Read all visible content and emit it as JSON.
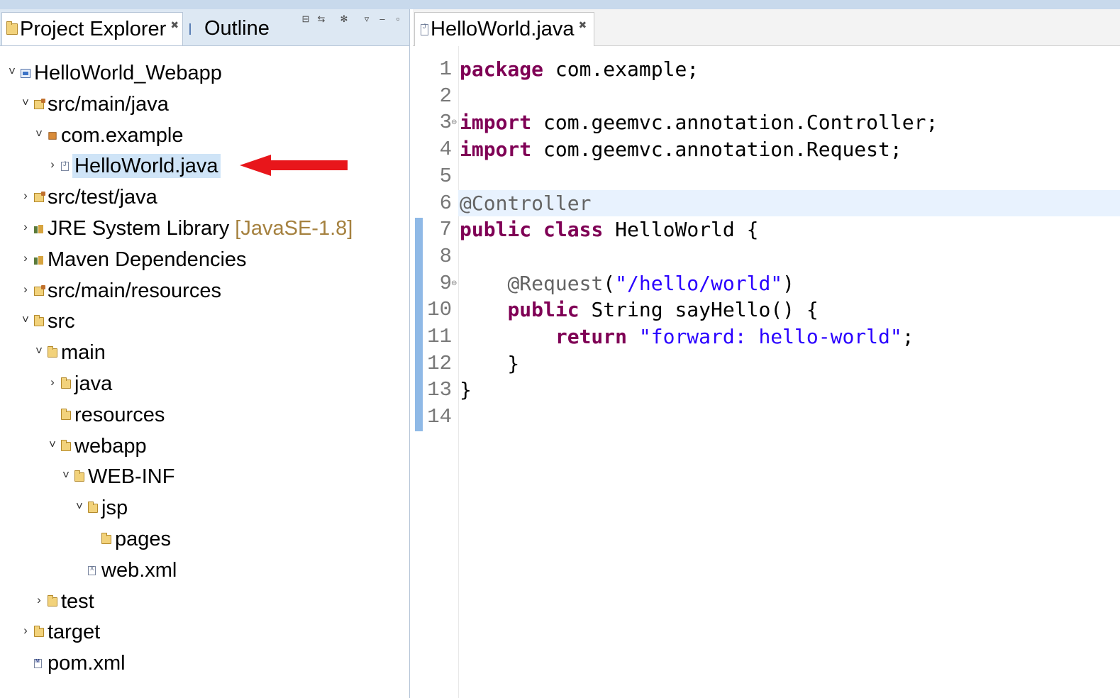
{
  "explorer": {
    "tabs": [
      {
        "label": "Project Explorer",
        "icon": "project-explorer-icon",
        "active": true
      },
      {
        "label": "Outline",
        "icon": "outline-icon",
        "active": false
      }
    ],
    "close_glyph": "✖",
    "tree": [
      {
        "label": "HelloWorld_Webapp",
        "depth": 0,
        "twisty": "˅",
        "icon": "project"
      },
      {
        "label": "src/main/java",
        "depth": 1,
        "twisty": "˅",
        "icon": "source-folder"
      },
      {
        "label": "com.example",
        "depth": 2,
        "twisty": "˅",
        "icon": "package"
      },
      {
        "label": "HelloWorld.java",
        "depth": 3,
        "twisty": "›",
        "icon": "java-file",
        "selected": true
      },
      {
        "label": "src/test/java",
        "depth": 1,
        "twisty": "›",
        "icon": "source-folder"
      },
      {
        "label": "JRE System Library",
        "decoration": "[JavaSE-1.8]",
        "depth": 1,
        "twisty": "›",
        "icon": "library"
      },
      {
        "label": "Maven Dependencies",
        "depth": 1,
        "twisty": "›",
        "icon": "library"
      },
      {
        "label": "src/main/resources",
        "depth": 1,
        "twisty": "›",
        "icon": "source-folder"
      },
      {
        "label": "src",
        "depth": 1,
        "twisty": "˅",
        "icon": "folder"
      },
      {
        "label": "main",
        "depth": 2,
        "twisty": "˅",
        "icon": "folder"
      },
      {
        "label": "java",
        "depth": 3,
        "twisty": "›",
        "icon": "folder"
      },
      {
        "label": "resources",
        "depth": 3,
        "twisty": "",
        "icon": "folder"
      },
      {
        "label": "webapp",
        "depth": 3,
        "twisty": "˅",
        "icon": "folder"
      },
      {
        "label": "WEB-INF",
        "depth": 4,
        "twisty": "˅",
        "icon": "folder"
      },
      {
        "label": "jsp",
        "depth": 5,
        "twisty": "˅",
        "icon": "folder"
      },
      {
        "label": "pages",
        "depth": 6,
        "twisty": "",
        "icon": "folder"
      },
      {
        "label": "web.xml",
        "depth": 5,
        "twisty": "",
        "icon": "xml-file"
      },
      {
        "label": "test",
        "depth": 2,
        "twisty": "›",
        "icon": "folder"
      },
      {
        "label": "target",
        "depth": 1,
        "twisty": "›",
        "icon": "folder"
      },
      {
        "label": "pom.xml",
        "depth": 1,
        "twisty": "",
        "icon": "pom-file"
      }
    ]
  },
  "editor": {
    "tab_label": "HelloWorld.java",
    "highlighted_line": 6,
    "lines": [
      {
        "n": "1",
        "fold": "",
        "tokens": [
          {
            "t": "package",
            "k": "kw"
          },
          {
            "t": " com.example;",
            "k": ""
          }
        ]
      },
      {
        "n": "2",
        "fold": "",
        "tokens": []
      },
      {
        "n": "3",
        "fold": "⊖",
        "tokens": [
          {
            "t": "import",
            "k": "kw"
          },
          {
            "t": " com.geemvc.annotation.Controller;",
            "k": ""
          }
        ]
      },
      {
        "n": "4",
        "fold": "",
        "tokens": [
          {
            "t": "import",
            "k": "kw"
          },
          {
            "t": " com.geemvc.annotation.Request;",
            "k": ""
          }
        ]
      },
      {
        "n": "5",
        "fold": "",
        "tokens": []
      },
      {
        "n": "6",
        "fold": "",
        "tokens": [
          {
            "t": "@Controller",
            "k": "ann"
          }
        ]
      },
      {
        "n": "7",
        "fold": "",
        "tokens": [
          {
            "t": "public",
            "k": "kw"
          },
          {
            "t": " ",
            "k": ""
          },
          {
            "t": "class",
            "k": "kw"
          },
          {
            "t": " HelloWorld {",
            "k": ""
          }
        ]
      },
      {
        "n": "8",
        "fold": "",
        "tokens": []
      },
      {
        "n": "9",
        "fold": "⊖",
        "tokens": [
          {
            "t": "    ",
            "k": ""
          },
          {
            "t": "@Request",
            "k": "ann"
          },
          {
            "t": "(",
            "k": ""
          },
          {
            "t": "\"/hello/world\"",
            "k": "str"
          },
          {
            "t": ")",
            "k": ""
          }
        ]
      },
      {
        "n": "10",
        "fold": "",
        "tokens": [
          {
            "t": "    ",
            "k": ""
          },
          {
            "t": "public",
            "k": "kw"
          },
          {
            "t": " String sayHello() {",
            "k": ""
          }
        ]
      },
      {
        "n": "11",
        "fold": "",
        "tokens": [
          {
            "t": "        ",
            "k": ""
          },
          {
            "t": "return",
            "k": "kw"
          },
          {
            "t": " ",
            "k": ""
          },
          {
            "t": "\"forward: hello-world\"",
            "k": "str"
          },
          {
            "t": ";",
            "k": ""
          }
        ]
      },
      {
        "n": "12",
        "fold": "",
        "tokens": [
          {
            "t": "    }",
            "k": ""
          }
        ]
      },
      {
        "n": "13",
        "fold": "",
        "tokens": [
          {
            "t": "}",
            "k": ""
          }
        ]
      },
      {
        "n": "14",
        "fold": "",
        "tokens": []
      }
    ]
  },
  "colors": {
    "keyword": "#7f0055",
    "annotation": "#646464",
    "string": "#2a00ff",
    "selection": "#cfe4f7",
    "arrow": "#e8161b"
  }
}
